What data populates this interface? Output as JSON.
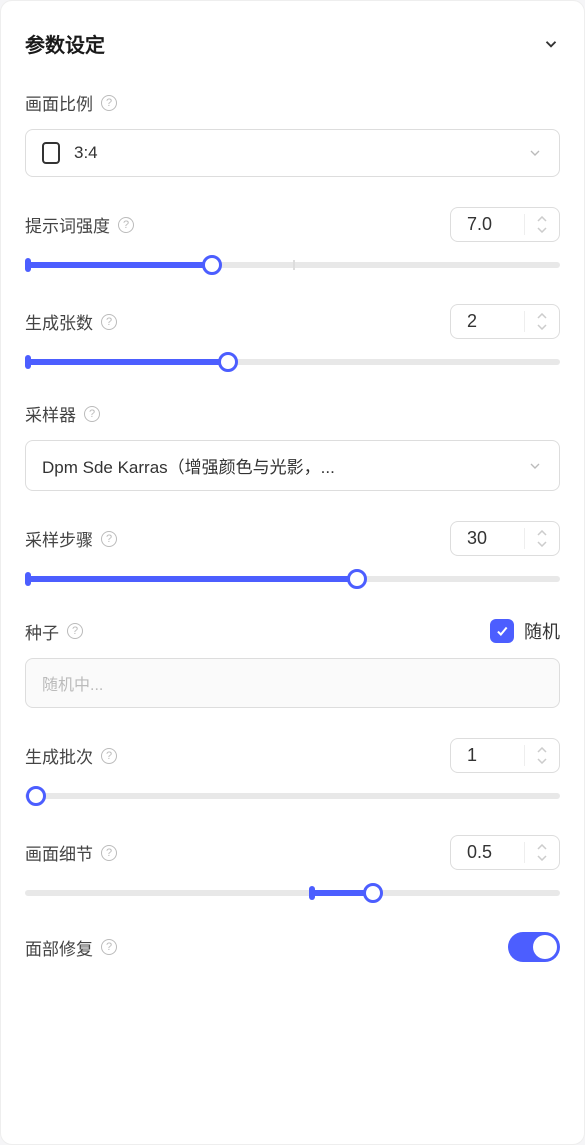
{
  "header": {
    "title": "参数设定"
  },
  "aspect_ratio": {
    "label": "画面比例",
    "value": "3:4"
  },
  "prompt_strength": {
    "label": "提示词强度",
    "value": "7.0",
    "percent": 35
  },
  "image_count": {
    "label": "生成张数",
    "value": "2",
    "percent": 38
  },
  "sampler": {
    "label": "采样器",
    "value": "Dpm Sde Karras（增强颜色与光影，..."
  },
  "steps": {
    "label": "采样步骤",
    "value": "30",
    "percent": 62
  },
  "seed": {
    "label": "种子",
    "random_label": "随机",
    "placeholder": "随机中..."
  },
  "batch": {
    "label": "生成批次",
    "value": "1",
    "percent": 0
  },
  "detail": {
    "label": "画面细节",
    "value": "0.5",
    "fill_start": 53,
    "fill_end": 65
  },
  "face_fix": {
    "label": "面部修复"
  }
}
